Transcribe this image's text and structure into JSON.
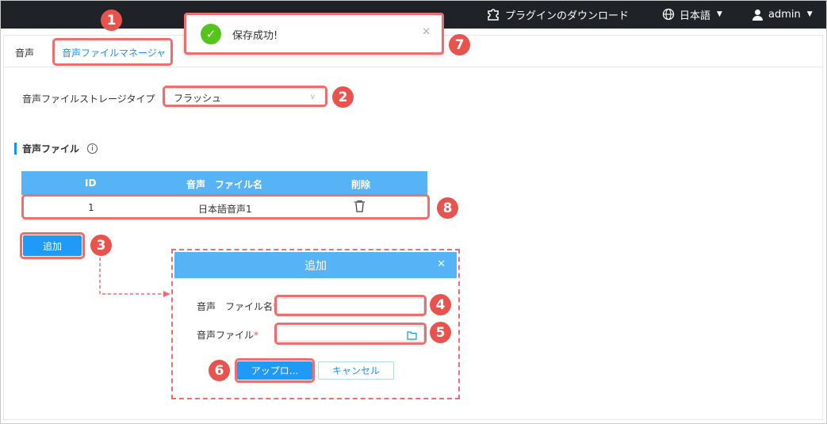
{
  "topbar": {
    "plugin_download": "プラグインのダウンロード",
    "language": "日本語",
    "user": "admin"
  },
  "tabs": [
    {
      "label": "音声"
    },
    {
      "label": "音声ファイルマネージャ"
    }
  ],
  "storage": {
    "label": "音声ファイルストレージタイプ",
    "selected": "フラッシュ"
  },
  "section": {
    "title": "音声ファイル"
  },
  "table": {
    "headers": [
      "ID",
      "音声　ファイル名",
      "削除"
    ],
    "rows": [
      {
        "id": "1",
        "name": "日本語音声1"
      }
    ]
  },
  "add_button": "追加",
  "dialog": {
    "title": "追加",
    "filename_label": "音声　ファイル名",
    "file_label": "音声ファイル",
    "upload_button": "アップロ...",
    "cancel_button": "キャンセル"
  },
  "toast": {
    "message": "保存成功!"
  },
  "callouts": [
    "1",
    "2",
    "3",
    "4",
    "5",
    "6",
    "7",
    "8"
  ],
  "colors": {
    "accent": "#1890ff",
    "header_blue": "#55b3f6",
    "callout_red": "#e8534d",
    "success": "#52c41a",
    "topbar": "#1f2327"
  }
}
